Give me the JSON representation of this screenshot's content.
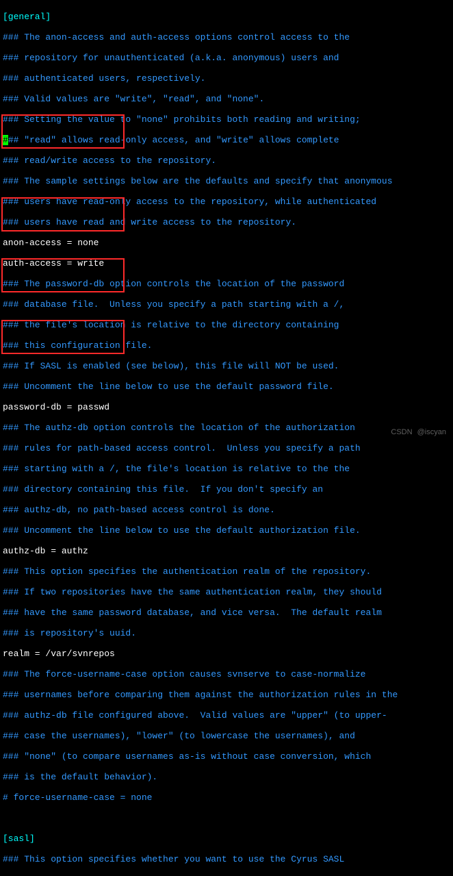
{
  "section_general": "[general]",
  "c01": "### The anon-access and auth-access options control access to the",
  "c02": "### repository for unauthenticated (a.k.a. anonymous) users and",
  "c03": "### authenticated users, respectively.",
  "c04": "### Valid values are \"write\", \"read\", and \"none\".",
  "c05": "### Setting the value to \"none\" prohibits both reading and writing;",
  "c06a": "#",
  "c06b": "## \"read\" allows read-only access, and \"write\" allows complete",
  "c07": "### read/write access to the repository.",
  "c08": "### The sample settings below are the defaults and specify that anonymous",
  "c09": "### users have read-only access to the repository, while authenticated",
  "c10": "### users have read and write access to the repository.",
  "l_anon": "anon-access = none",
  "l_auth": "auth-access = write",
  "c11": "### The password-db option controls the location of the password",
  "c12": "### database file.  Unless you specify a path starting with a /,",
  "c13": "### the file's location is relative to the directory containing",
  "c14": "### this configuration file.",
  "c15": "### If SASL is enabled (see below), this file will NOT be used.",
  "c16": "### Uncomment the line below to use the default password file.",
  "l_pwd": "password-db = passwd",
  "c17": "### The authz-db option controls the location of the authorization",
  "c18": "### rules for path-based access control.  Unless you specify a path",
  "c19": "### starting with a /, the file's location is relative to the the",
  "c20": "### directory containing this file.  If you don't specify an",
  "c21": "### authz-db, no path-based access control is done.",
  "c22": "### Uncomment the line below to use the default authorization file.",
  "l_authz": "authz-db = authz",
  "c23": "### This option specifies the authentication realm of the repository.",
  "c24": "### If two repositories have the same authentication realm, they should",
  "c25": "### have the same password database, and vice versa.  The default realm",
  "c26": "### is repository's uuid.",
  "l_realm": "realm = /var/svnrepos",
  "c27": "### The force-username-case option causes svnserve to case-normalize",
  "c28": "### usernames before comparing them against the authorization rules in the",
  "c29": "### authz-db file configured above.  Valid values are \"upper\" (to upper-",
  "c30": "### case the usernames), \"lower\" (to lowercase the usernames), and",
  "c31": "### \"none\" (to compare usernames as-is without case conversion, which",
  "c32": "### is the default behavior).",
  "c33": "# force-username-case = none",
  "section_sasl": "[sasl]",
  "c34": "### This option specifies whether you want to use the Cyrus SASL",
  "watermark1": "CSDN",
  "watermark2": "@iscyan"
}
